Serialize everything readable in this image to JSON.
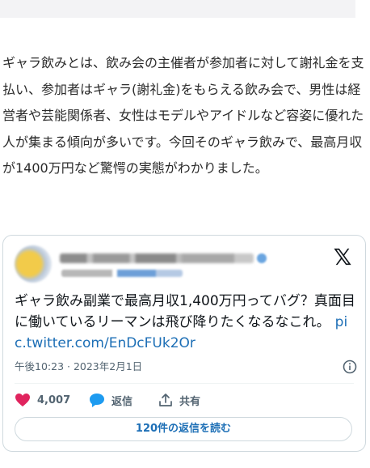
{
  "article": {
    "paragraph": "ギャラ飲みとは、飲み会の主催者が参加者に対して謝礼金を支払い、参加者はギャラ(謝礼金)をもらえる飲み会で、男性は経営者や芸能関係者、女性はモデルやアイドルなど容姿に優れた人が集まる傾向が多いです。今回そのギャラ飲みで、最高月収が1400万円など驚愕の実態がわかりました。"
  },
  "tweet": {
    "text": "ギャラ飲み副業で最高月収1,400万円ってバグ？真面目に働いているリーマンは飛び降りたくなるなこれ。",
    "link": "pic.twitter.com/EnDcFUk2Or",
    "date": "午後10:23 · 2023年2月1日",
    "logo": "𝕏",
    "likes": "4,007",
    "reply_label": "返信",
    "share_label": "共有",
    "read_replies_label": "120件の返信を読む",
    "colors": {
      "like": "#e0245e",
      "reply": "#1d9bf0",
      "link": "#1d6fb6",
      "muted": "#536471"
    },
    "icons": [
      "heart-icon",
      "reply-bubble-icon",
      "share-icon",
      "info-icon",
      "x-logo-icon"
    ]
  }
}
